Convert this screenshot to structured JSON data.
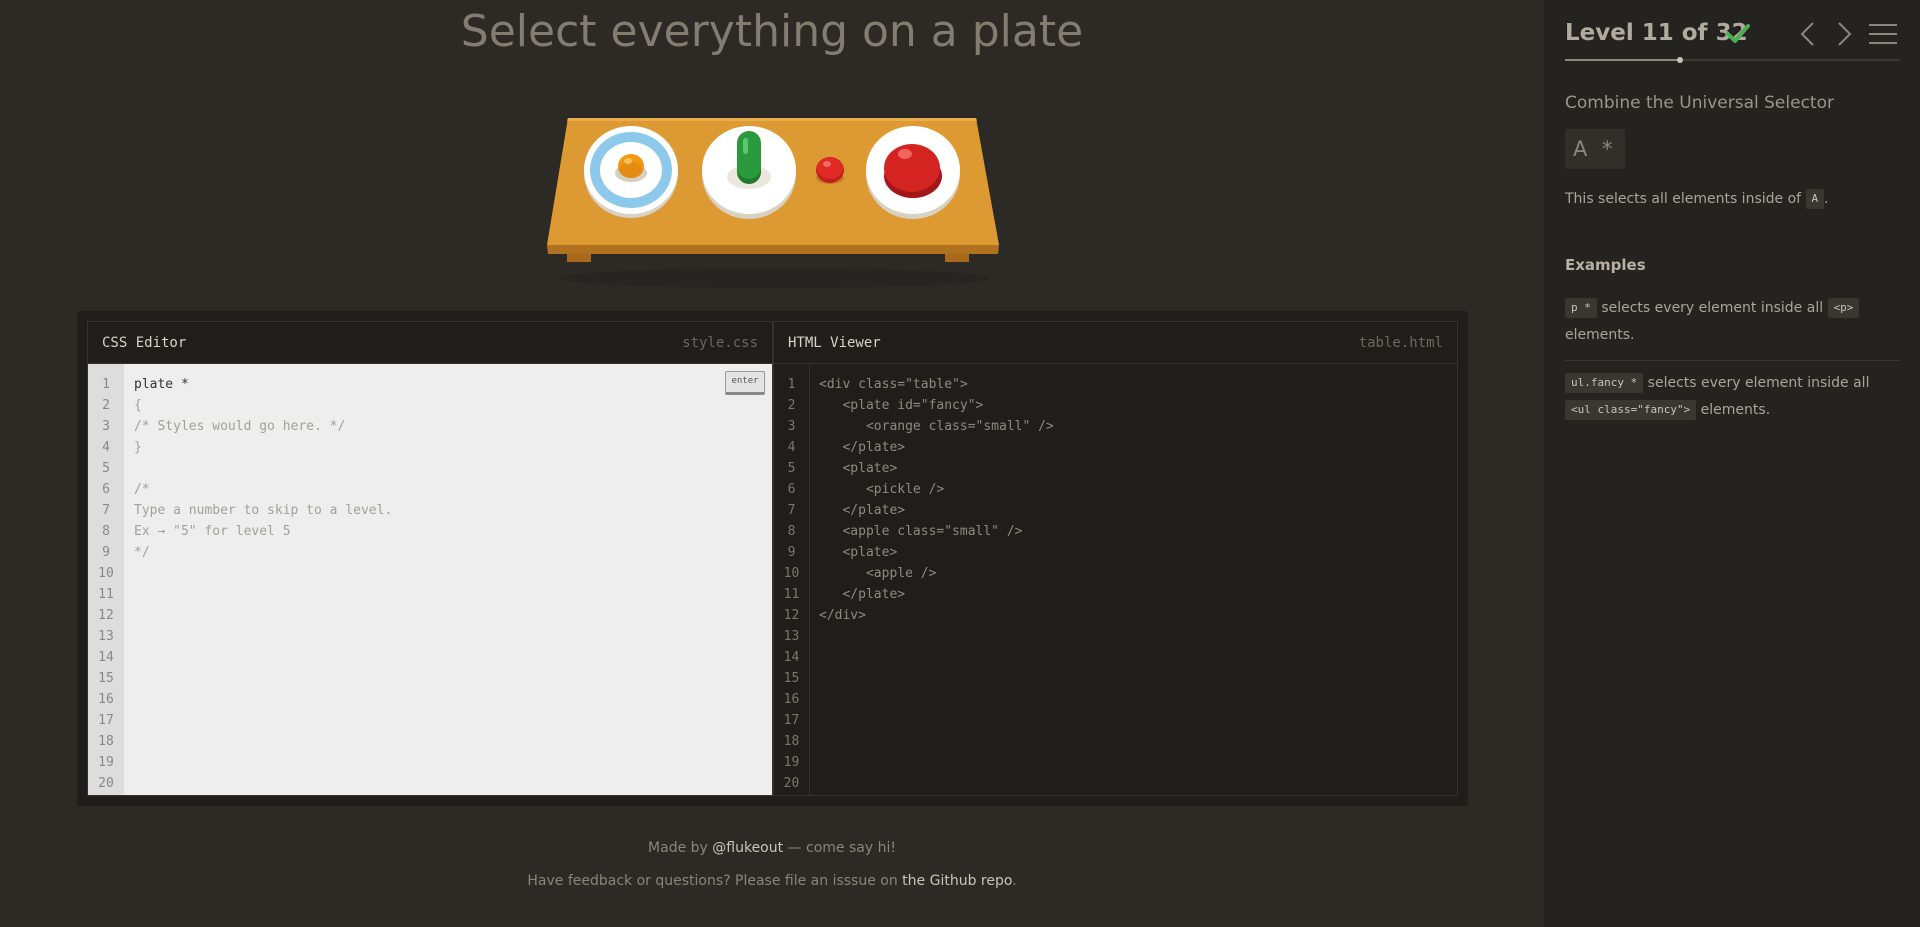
{
  "level_title": "Select everything on a plate",
  "css_editor": {
    "title": "CSS Editor",
    "filename": "style.css",
    "input_value": "plate *",
    "enter_label": "enter",
    "lines": [
      "{",
      "/* Styles would go here. */",
      "}",
      "",
      "/*",
      "Type a number to skip to a level.",
      "Ex → \"5\" for level 5",
      "*/"
    ],
    "line_numbers": [
      "1",
      "2",
      "3",
      "4",
      "5",
      "6",
      "7",
      "8",
      "9",
      "10",
      "11",
      "12",
      "13",
      "14",
      "15",
      "16",
      "17",
      "18",
      "19",
      "20"
    ]
  },
  "html_viewer": {
    "title": "HTML Viewer",
    "filename": "table.html",
    "lines": [
      "<div class=\"table\">",
      "   <plate id=\"fancy\">",
      "      <orange class=\"small\" />",
      "   </plate>",
      "   <plate>",
      "      <pickle />",
      "   </plate>",
      "   <apple class=\"small\" />",
      "   <plate>",
      "      <apple />",
      "   </plate>",
      "</div>"
    ],
    "line_numbers": [
      "1",
      "2",
      "3",
      "4",
      "5",
      "6",
      "7",
      "8",
      "9",
      "10",
      "11",
      "12",
      "13",
      "14",
      "15",
      "16",
      "17",
      "18",
      "19",
      "20"
    ]
  },
  "footer": {
    "made_by_prefix": "Made by ",
    "made_by_link": "@flukeout",
    "made_by_suffix": " — come say hi!",
    "feedback_prefix": "Have feedback or questions? Please file an isssue on ",
    "feedback_link": "the Github repo",
    "feedback_suffix": "."
  },
  "sidebar": {
    "level_text": "Level 11 of 32",
    "completed": true,
    "progress_fraction": 0.34375,
    "selector_name": "Combine the Universal Selector",
    "syntax": "A  *",
    "description_prefix": "This selects all elements inside of ",
    "description_tag": "A",
    "description_suffix": ".",
    "examples_title": "Examples",
    "examples": [
      {
        "code": "p  *",
        "text_before": " selects every element inside all ",
        "tag": "<p>",
        "text_after": " elements."
      },
      {
        "code": "ul.fancy  *",
        "text_before": " selects every element inside all ",
        "tag": "<ul class=\"fancy\">",
        "text_after": " elements."
      }
    ]
  },
  "colors": {
    "background": "#2d2a25",
    "sidebar": "#25231f",
    "table_wood": "#d4922e",
    "check_green": "#4cb050",
    "apple_red": "#d42421",
    "pickle_green": "#2a9a3d",
    "orange": "#f09a14",
    "fancy_plate_rim": "#8cc9ea"
  }
}
